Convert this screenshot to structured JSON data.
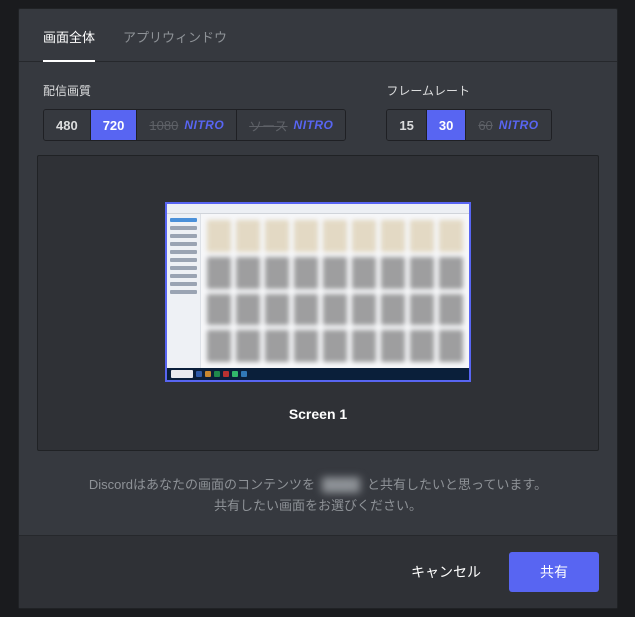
{
  "tabs": {
    "entire": "画面全体",
    "appwin": "アプリウィンドウ"
  },
  "quality": {
    "label": "配信画質",
    "options": [
      "480",
      "720",
      "1080",
      "ソース"
    ],
    "selected": "720",
    "locked": [
      "1080",
      "ソース"
    ],
    "lock_tag": "NITRO"
  },
  "framerate": {
    "label": "フレームレート",
    "options": [
      "15",
      "30",
      "60"
    ],
    "selected": "30",
    "locked": [
      "60"
    ],
    "lock_tag": "NITRO"
  },
  "screen": {
    "label": "Screen 1"
  },
  "hint": {
    "pre": "Discordはあなたの画面のコンテンツを ",
    "target": "████",
    "post": " と共有したいと思っています。",
    "line2": "共有したい画面をお選びください。"
  },
  "footer": {
    "cancel": "キャンセル",
    "share": "共有"
  }
}
